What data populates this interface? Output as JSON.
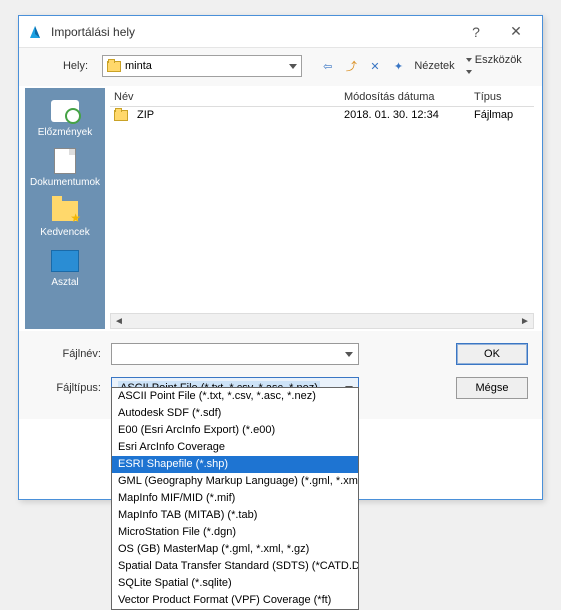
{
  "window": {
    "title": "Importálási hely",
    "help_icon": "?",
    "close_icon": "✕"
  },
  "toolbar": {
    "location_label": "Hely:",
    "location_value": "minta",
    "views_label": "Nézetek",
    "tools_label": "Eszközök"
  },
  "sidebar": {
    "items": [
      {
        "label": "Előzmények"
      },
      {
        "label": "Dokumentumok"
      },
      {
        "label": "Kedvencek"
      },
      {
        "label": "Asztal"
      }
    ]
  },
  "columns": {
    "name": "Név",
    "date": "Módosítás dátuma",
    "type": "Típus"
  },
  "rows": [
    {
      "name": "ZIP",
      "date": "2018. 01. 30. 12:34",
      "type": "Fájlmap"
    }
  ],
  "fields": {
    "filename_label": "Fájlnév:",
    "filename_value": "",
    "filetype_label": "Fájltípus:",
    "filetype_value": "ASCII Point File (*.txt, *.csv, *.asc, *.nez)"
  },
  "buttons": {
    "ok": "OK",
    "cancel": "Mégse"
  },
  "filetype_options": [
    "ASCII Point File (*.txt, *.csv, *.asc, *.nez)",
    "Autodesk SDF (*.sdf)",
    "E00 (Esri ArcInfo Export) (*.e00)",
    "Esri ArcInfo Coverage",
    "ESRI Shapefile (*.shp)",
    "GML (Geography Markup Language) (*.gml, *.xml, *.gz)",
    "MapInfo MIF/MID (*.mif)",
    "MapInfo TAB (MITAB) (*.tab)",
    "MicroStation File (*.dgn)",
    "OS (GB) MasterMap (*.gml, *.xml, *.gz)",
    "Spatial Data Transfer Standard (SDTS) (*CATD.DDF)",
    "SQLite Spatial (*.sqlite)",
    "Vector Product Format (VPF) Coverage (*ft)"
  ],
  "filetype_highlight_index": 4
}
